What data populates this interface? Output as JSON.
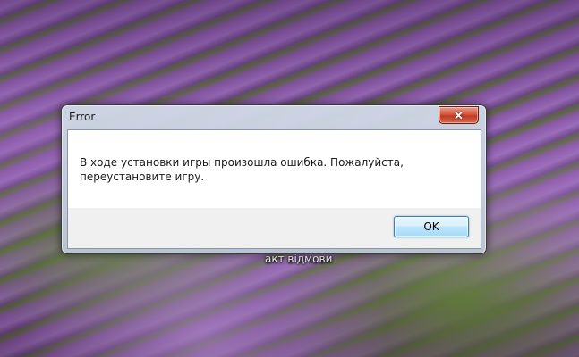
{
  "desktop": {
    "label": "акт відмови"
  },
  "dialog": {
    "title": "Error",
    "close_icon": "close-icon",
    "message": "В ходе установки игры произошла ошибка. Пожалуйста, переустановите игру.",
    "ok_label": "OK"
  },
  "colors": {
    "close_button": "#c23a22",
    "ok_button_border": "#3c7fb1",
    "wallpaper": "#7d5199"
  }
}
